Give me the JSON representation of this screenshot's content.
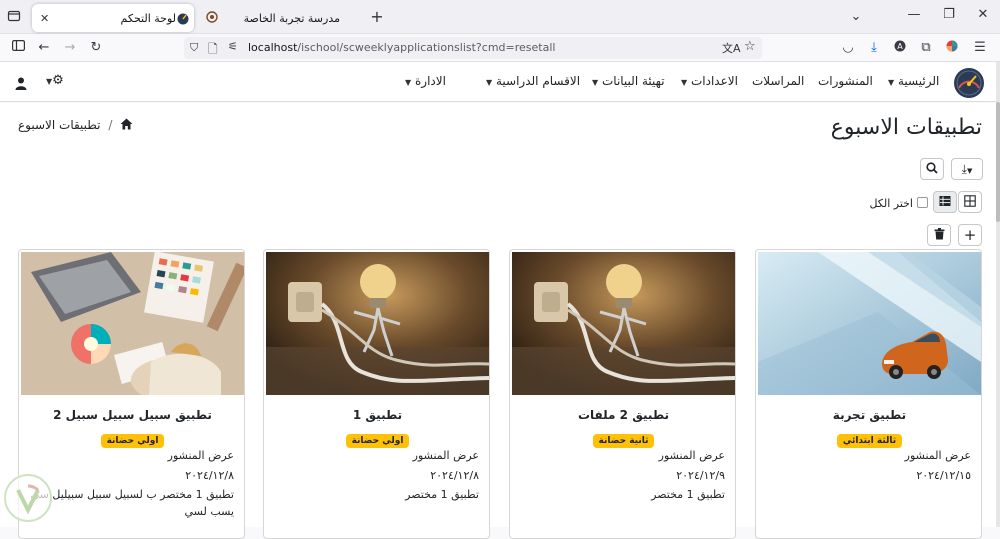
{
  "browser": {
    "tabs": [
      {
        "title": "لوحة التحكم",
        "active": true
      },
      {
        "title": "مدرسة تجربة الخاصة",
        "active": false
      }
    ],
    "url_host": "localhost",
    "url_path": "/ischool/scweeklyapplicationslist?cmd=resetall"
  },
  "nav": {
    "menu": [
      {
        "label": "الرئيسية",
        "has_dropdown": true
      },
      {
        "label": "المنشورات",
        "has_dropdown": false
      },
      {
        "label": "المراسلات",
        "has_dropdown": false
      },
      {
        "label": "الاعدادات",
        "has_dropdown": true
      },
      {
        "label": "تهيئة البيانات",
        "has_dropdown": true
      },
      {
        "label": "الاقسام الدراسية",
        "has_dropdown": true
      },
      {
        "label": "الادارة",
        "has_dropdown": true
      }
    ]
  },
  "page": {
    "title": "تطبيقات الاسبوع",
    "breadcrumb_current": "تطبيقات الاسبوع",
    "select_all_label": "اختر الكل"
  },
  "cards": [
    {
      "title": "تطبيق تجربة",
      "badge": "ثالثة ابتدائي",
      "link": "عرض المنشور",
      "date": "٢٠٢٤/١٢/١٥",
      "desc": "",
      "image": "car-on-blue-background"
    },
    {
      "title": "تطبيق 2 ملفات",
      "badge": "ثانية حضانة",
      "link": "عرض المنشور",
      "date": "٢٠٢٤/١٢/٩",
      "desc": "تطبيق 1 مختصر",
      "image": "lightbulb-figure-plug"
    },
    {
      "title": "تطبيق 1",
      "badge": "اولي حضانة",
      "link": "عرض المنشور",
      "date": "٢٠٢٤/١٢/٨",
      "desc": "تطبيق 1 مختصر",
      "image": "lightbulb-figure-plug"
    },
    {
      "title": "تطبيق سبيل سبيل سبيل 2",
      "badge": "اولي حضانة",
      "link": "عرض المنشور",
      "date": "٢٠٢٤/١٢/٨",
      "desc": "تطبيق 1 مختصر ب لسبيل سبيل سبيليل سي يسب لسي",
      "image": "designer-desk-laptop"
    }
  ],
  "colors": {
    "badge": "#ffc107",
    "accent_dark": "#2b3a55"
  }
}
